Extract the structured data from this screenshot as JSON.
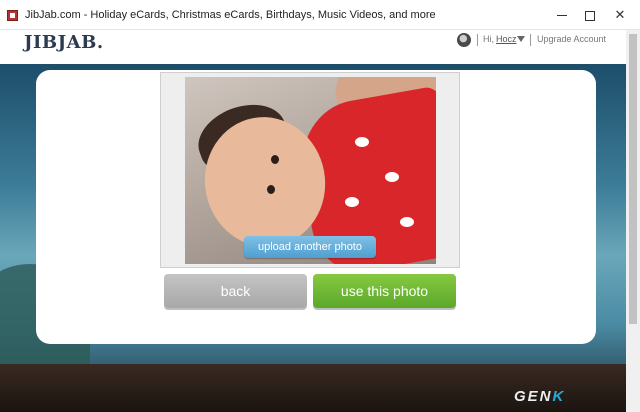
{
  "window": {
    "title": "JibJab.com - Holiday eCards, Christmas eCards, Birthdays, Music Videos, and more"
  },
  "header": {
    "logo": "JIBJAB.",
    "greeting": "Hi,",
    "username": "Hocz",
    "upgrade_link": "Upgrade Account"
  },
  "editor": {
    "upload_label": "upload another photo",
    "back_label": "back",
    "use_label": "use this photo"
  },
  "watermark": {
    "text_main": "GEN",
    "text_accent": "K"
  },
  "colors": {
    "use_button": "#6db535",
    "back_button": "#b6b6b6",
    "upload_button": "#5eaad8",
    "logo": "#2d3b52"
  }
}
